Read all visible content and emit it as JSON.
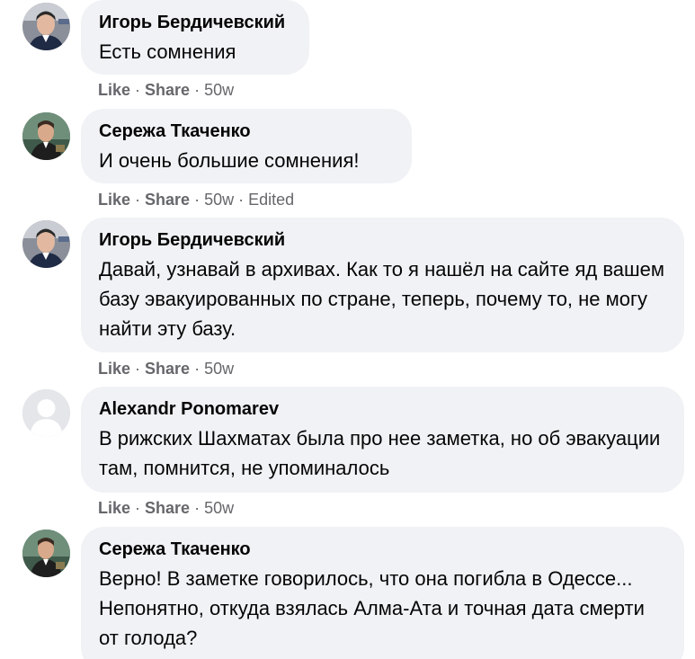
{
  "comments": [
    {
      "author": "Игорь Бердичевский",
      "avatar": "user-photo-igor",
      "text": "Есть сомнения",
      "like": "Like",
      "share": "Share",
      "time": "50w",
      "edited": ""
    },
    {
      "author": "Сережа Ткаченко",
      "avatar": "user-photo-serezha",
      "text": "И очень большие сомнения!",
      "like": "Like",
      "share": "Share",
      "time": "50w",
      "edited": "Edited"
    },
    {
      "author": "Игорь Бердичевский",
      "avatar": "user-photo-igor",
      "text": "Давай, узнавай в архивах. Как то я нашёл на сайте яд вашем базу эвакуированных по стране, теперь, почему то, не могу найти эту базу.",
      "like": "Like",
      "share": "Share",
      "time": "50w",
      "edited": ""
    },
    {
      "author": "Alexandr Ponomarev",
      "avatar": "default-avatar",
      "text": "В рижских Шахматах была про нее заметка, но об эвакуации там, помнится, не упоминалось",
      "like": "Like",
      "share": "Share",
      "time": "50w",
      "edited": ""
    },
    {
      "author": "Сережа Ткаченко",
      "avatar": "user-photo-serezha",
      "text": "Верно! В заметке говорилось, что она погибла в Одессе... Непонятно, откуда взялась Алма-Ата и точная дата смерти от голода?",
      "like": "",
      "share": "",
      "time": "",
      "edited": ""
    }
  ],
  "colors": {
    "bubble": "#f0f2f5",
    "meta": "#65676b",
    "text": "#050505"
  }
}
